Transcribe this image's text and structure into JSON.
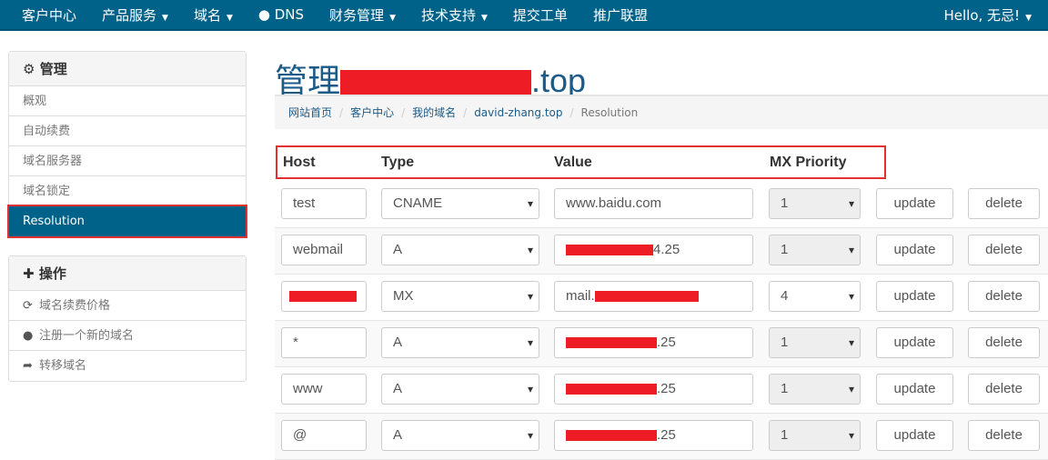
{
  "nav": {
    "items": [
      "客户中心",
      "产品服务",
      "域名",
      "DNS",
      "财务管理",
      "技术支持",
      "提交工单",
      "推广联盟"
    ],
    "dropdowns": [
      false,
      true,
      true,
      false,
      true,
      true,
      false,
      false
    ],
    "user": "Hello, 无忌!"
  },
  "sidebar": {
    "manage_title": "管理",
    "manage_items": [
      "概观",
      "自动续费",
      "域名服务器",
      "域名锁定",
      "Resolution"
    ],
    "actions_title": "操作",
    "action_items": [
      "域名续费价格",
      "注册一个新的域名",
      "转移域名"
    ]
  },
  "title": {
    "prefix": "管理",
    "suffix": ".top"
  },
  "breadcrumb": [
    "网站首页",
    "客户中心",
    "我的域名",
    "david-zhang.top",
    "Resolution"
  ],
  "table": {
    "headers": [
      "Host",
      "Type",
      "Value",
      "MX Priority"
    ],
    "update_label": "update",
    "delete_label": "delete",
    "rows": [
      {
        "host": "test",
        "type": "CNAME",
        "value": "www.baidu.com",
        "priority": "1",
        "disabled": true
      },
      {
        "host": "webmail",
        "type": "A",
        "value": "4.25",
        "priority": "1",
        "disabled": true
      },
      {
        "host": "",
        "type": "MX",
        "value": "mail.",
        "priority": "4",
        "disabled": false
      },
      {
        "host": "*",
        "type": "A",
        "value": ".25",
        "priority": "1",
        "disabled": true
      },
      {
        "host": "www",
        "type": "A",
        "value": ".25",
        "priority": "1",
        "disabled": true
      },
      {
        "host": "@",
        "type": "A",
        "value": ".25",
        "priority": "1",
        "disabled": true
      }
    ]
  },
  "colors": {
    "nav": "#006288",
    "highlight": "#e03030",
    "redaction": "#ee1c25"
  }
}
